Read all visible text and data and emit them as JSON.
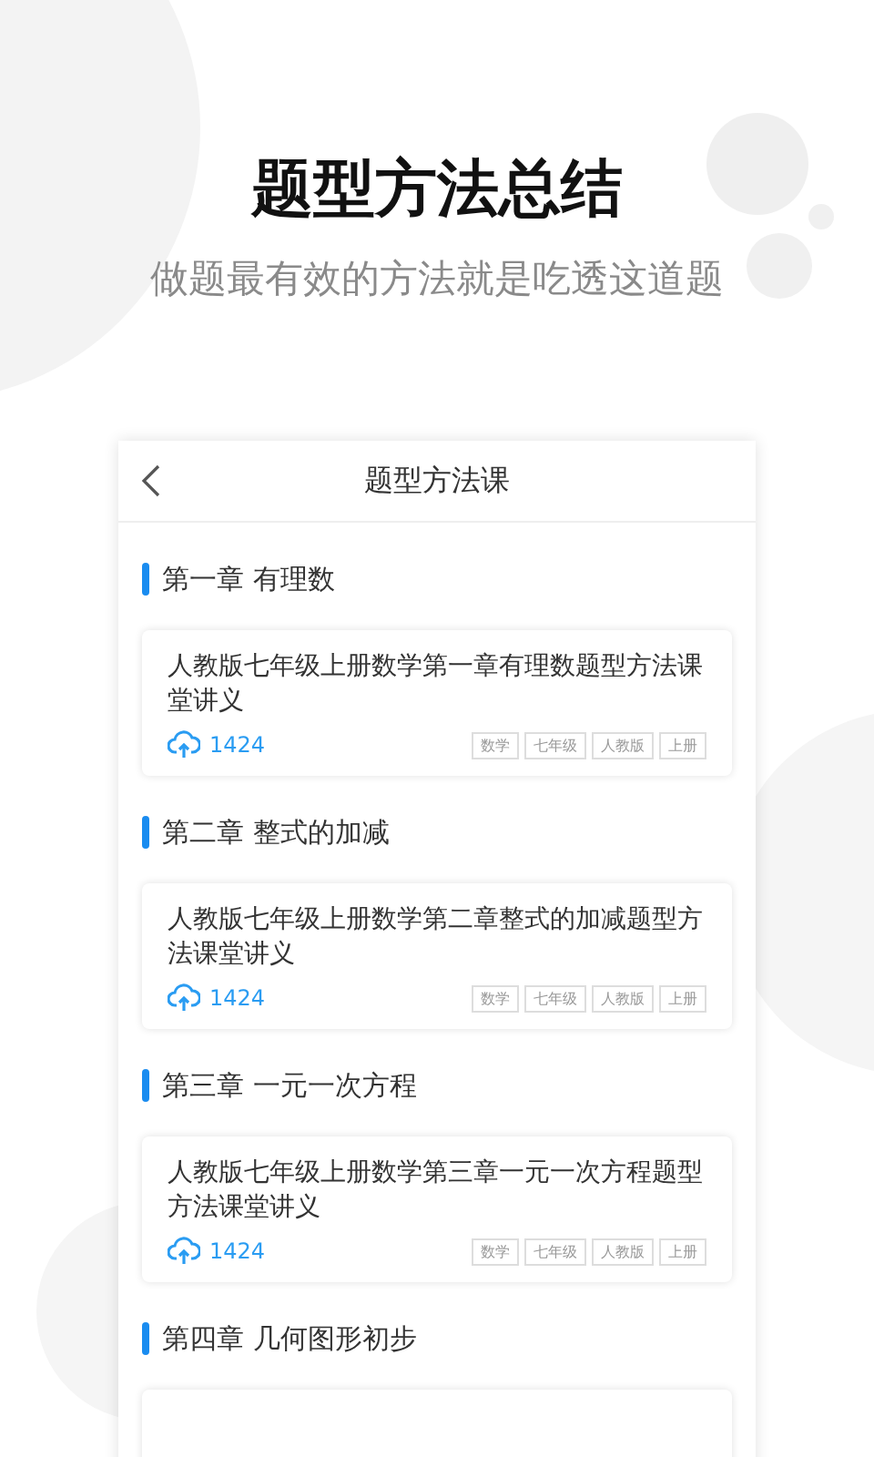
{
  "headline": "题型方法总结",
  "subtitle": "做题最有效的方法就是吃透这道题",
  "screen": {
    "title": "题型方法课",
    "chapters": [
      {
        "title": "第一章 有理数",
        "doc": {
          "title": "人教版七年级上册数学第一章有理数题型方法课堂讲义",
          "count": "1424",
          "tags": [
            "数学",
            "七年级",
            "人教版",
            "上册"
          ]
        }
      },
      {
        "title": "第二章 整式的加减",
        "doc": {
          "title": "人教版七年级上册数学第二章整式的加减题型方法课堂讲义",
          "count": "1424",
          "tags": [
            "数学",
            "七年级",
            "人教版",
            "上册"
          ]
        }
      },
      {
        "title": "第三章 一元一次方程",
        "doc": {
          "title": "人教版七年级上册数学第三章一元一次方程题型方法课堂讲义",
          "count": "1424",
          "tags": [
            "数学",
            "七年级",
            "人教版",
            "上册"
          ]
        }
      },
      {
        "title": "第四章 几何图形初步"
      }
    ]
  }
}
